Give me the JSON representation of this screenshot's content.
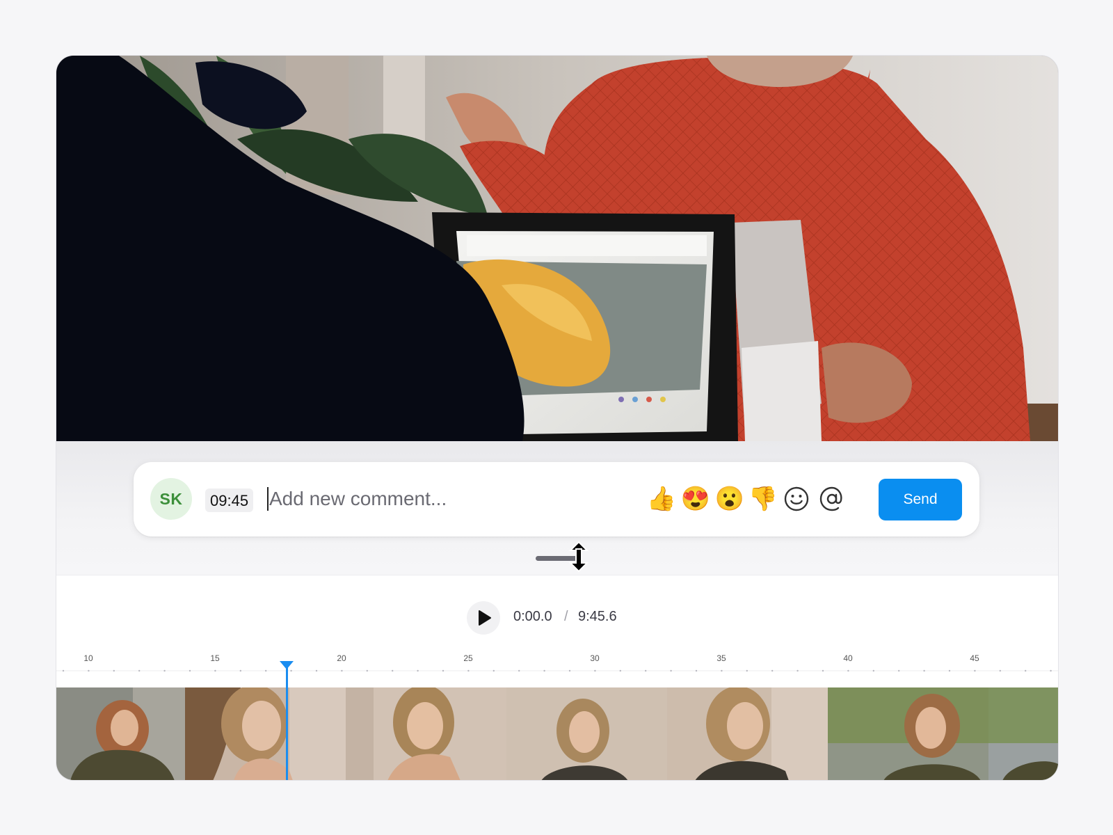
{
  "comment": {
    "avatar_initials": "SK",
    "timestamp": "09:45",
    "placeholder": "Add new comment...",
    "reactions": [
      {
        "name": "thumbs-up",
        "glyph": "👍"
      },
      {
        "name": "heart-eyes",
        "glyph": "😍"
      },
      {
        "name": "surprised",
        "glyph": "😮"
      },
      {
        "name": "thumbs-down",
        "glyph": "👎"
      }
    ],
    "emoji_picker_icon": "smiley-icon",
    "mention_icon": "at-icon",
    "send_label": "Send",
    "send_color": "#0a8ef0",
    "avatar_bg": "#e3f3e2",
    "avatar_fg": "#3c8f3a"
  },
  "player": {
    "current_time": "0:00.0",
    "separator": "/",
    "total_time": "9:45.6",
    "play_icon": "play-icon"
  },
  "timeline": {
    "tick_labels": [
      "10",
      "15",
      "20",
      "25",
      "30",
      "35",
      "40",
      "45"
    ],
    "playhead_color": "#1a8df0",
    "frame_count": 7
  }
}
